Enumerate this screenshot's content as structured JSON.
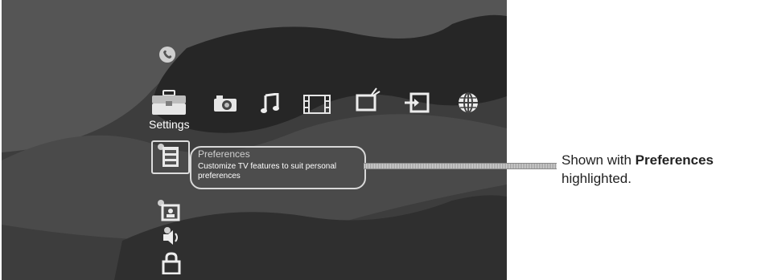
{
  "menu": {
    "category_label": "Settings",
    "top_icons": [
      "phone-icon"
    ],
    "media_icons": [
      "settings-toolbox-icon",
      "photo-icon",
      "music-icon",
      "video-icon",
      "tv-icon",
      "input-icon",
      "network-icon"
    ],
    "sub_icons": [
      "preferences-icon",
      "picture-settings-icon",
      "sound-icon",
      "parental-lock-icon"
    ]
  },
  "tooltip": {
    "title": "Preferences",
    "description": "Customize TV features to suit personal preferences"
  },
  "caption": {
    "line1_prefix": "Shown with ",
    "line1_bold": "Preferences",
    "line2": "highlighted."
  }
}
